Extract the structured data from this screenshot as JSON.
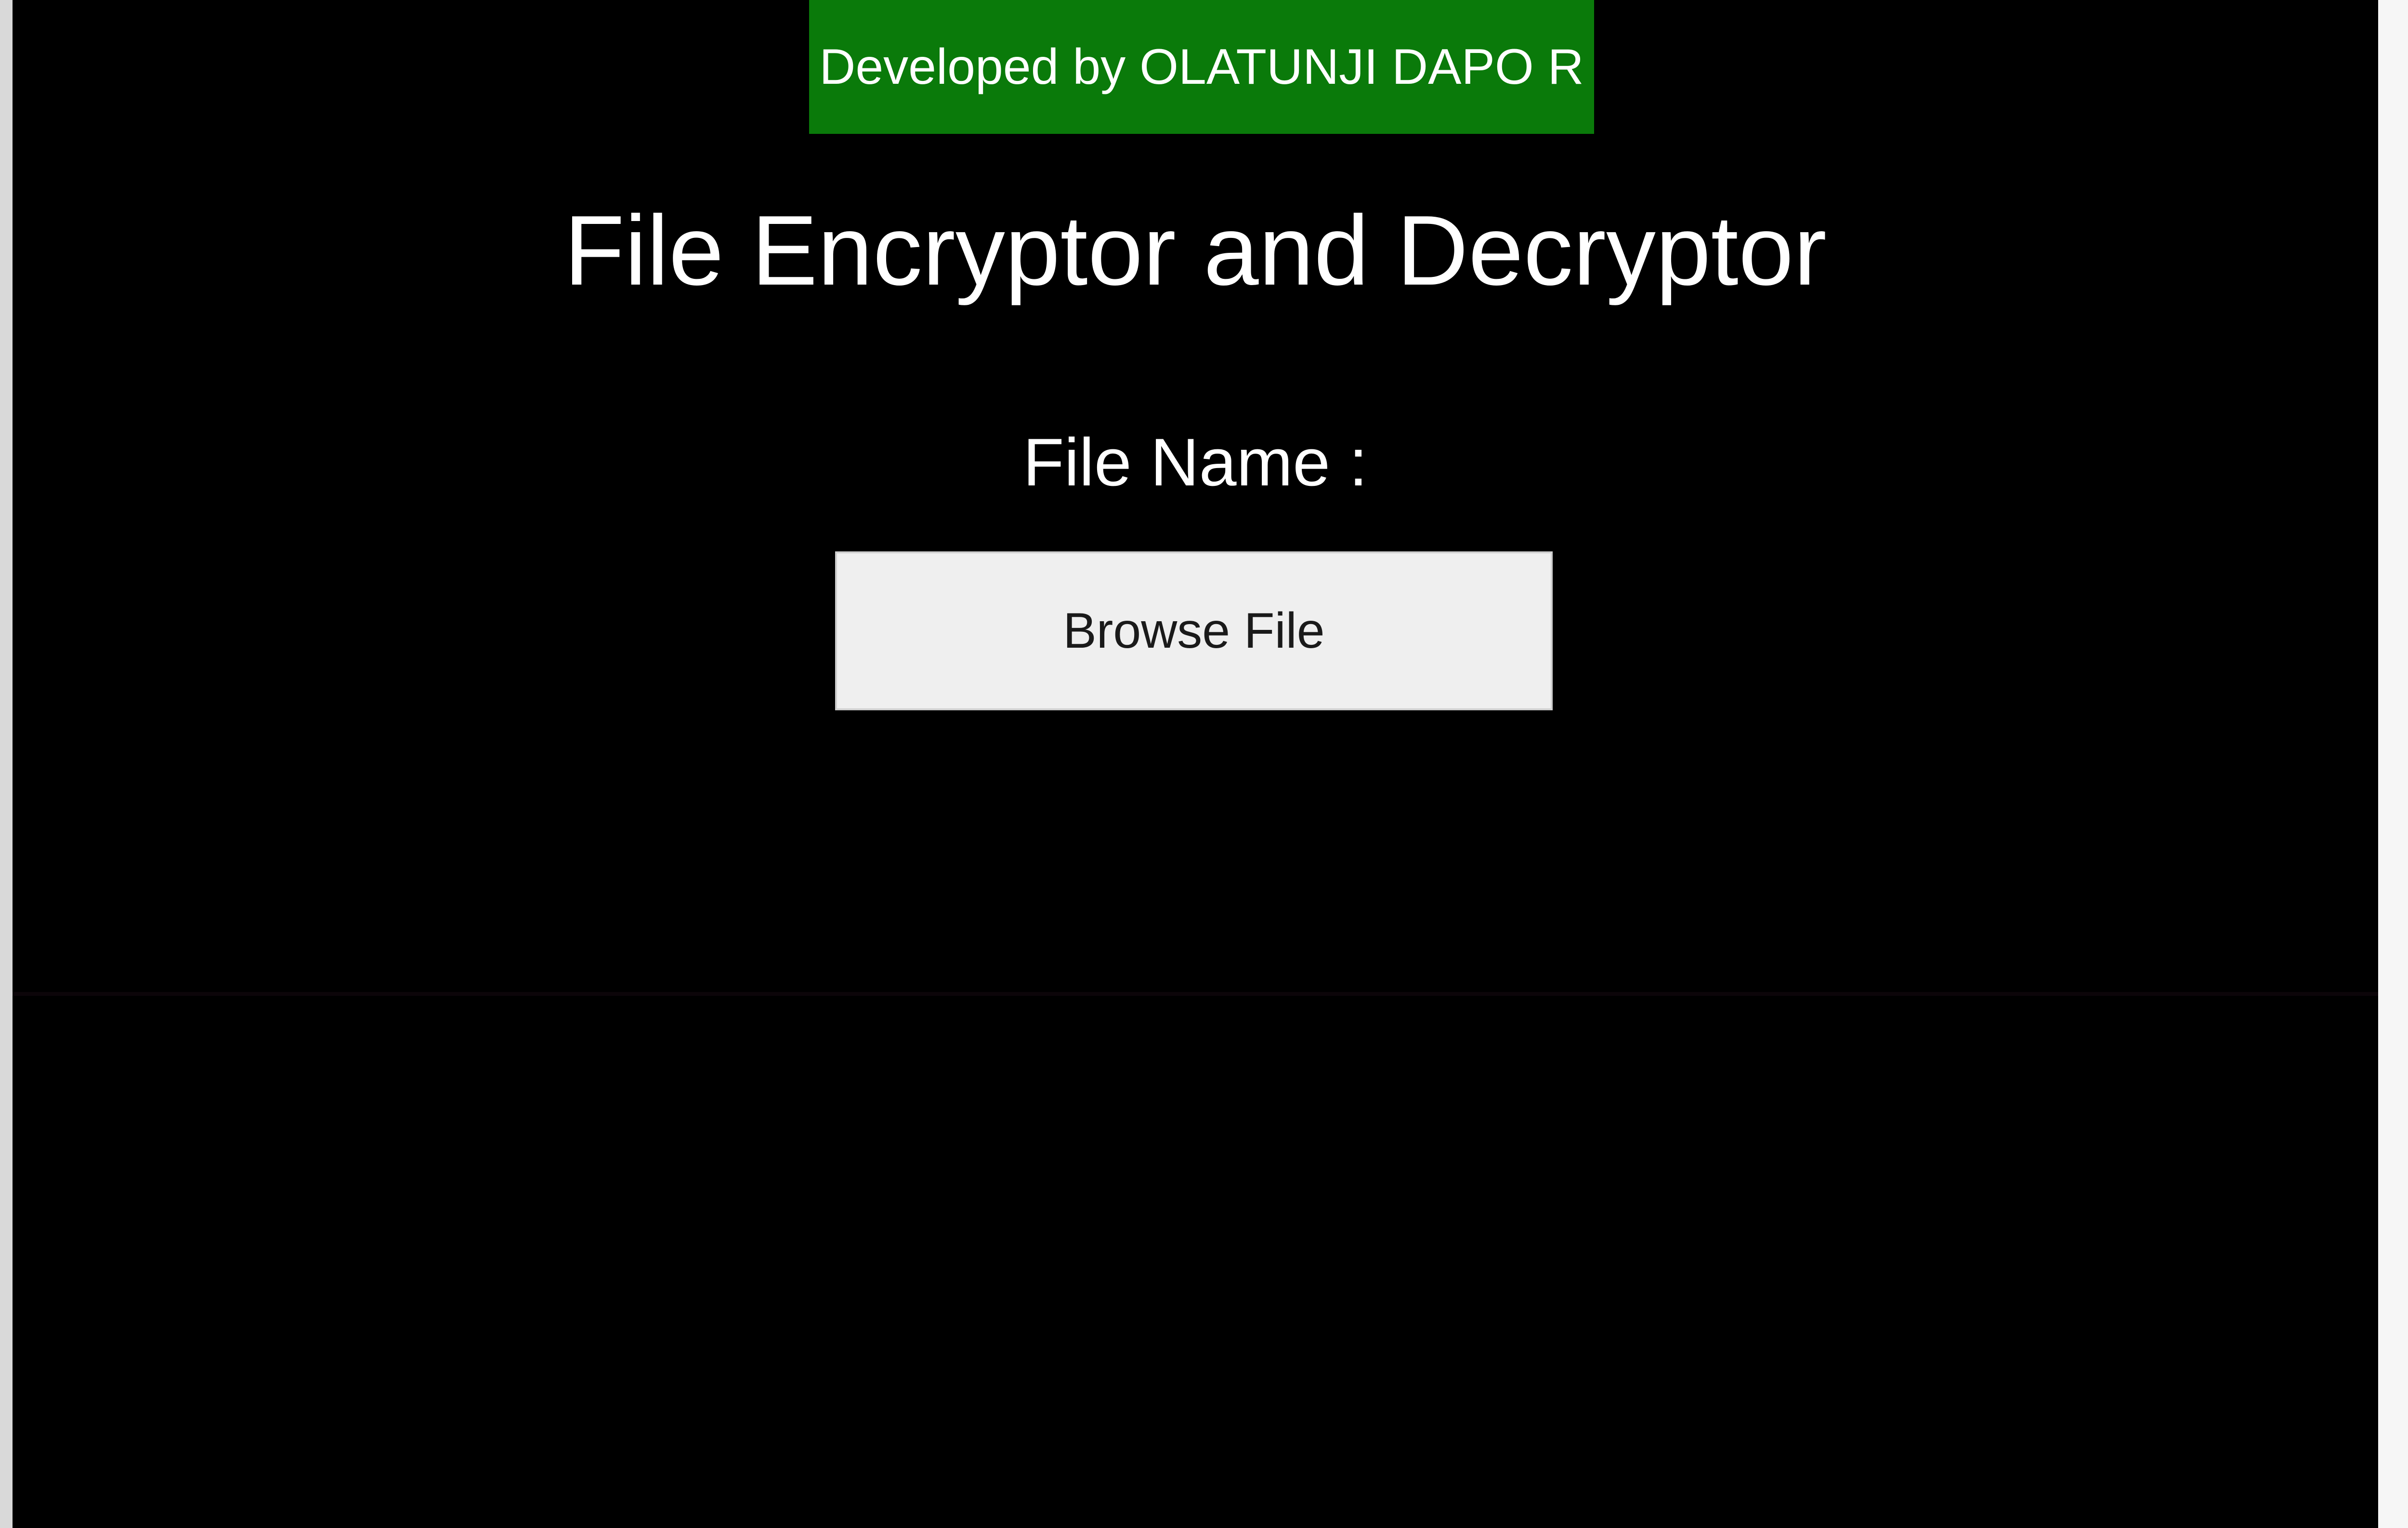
{
  "window": {
    "credit_text": "Developed by OLATUNJI DAPO R",
    "title": "File Encryptor and Decryptor",
    "file_name_label": "File Name :",
    "browse_button_label": "Browse File"
  },
  "colors": {
    "background": "#000000",
    "credit_banner": "#0a7a0a",
    "text": "#ffffff",
    "button_face": "#efefef"
  }
}
